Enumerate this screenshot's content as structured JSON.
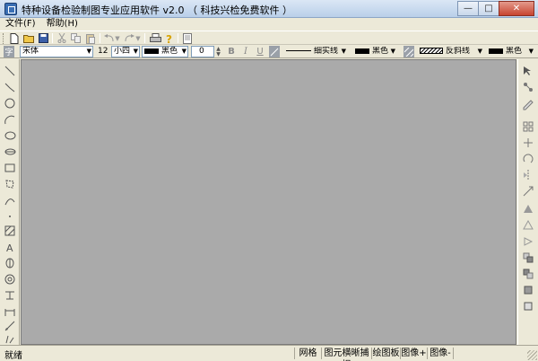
{
  "window": {
    "title": "特种设备检验制图专业应用软件 v2.0 （ 科技兴检免费软件 ）",
    "minimize": "—",
    "maximize": "□",
    "close": "✕"
  },
  "menu": {
    "items": [
      {
        "label": "文件(F)"
      },
      {
        "label": "帮助(H)"
      }
    ]
  },
  "toolbar1": {
    "icons": [
      "new-icon",
      "open-icon",
      "save-icon",
      "cut-icon",
      "copy-icon",
      "paste-icon",
      "undo-icon",
      "redo-icon",
      "print-icon",
      "help-icon",
      "preview-icon"
    ]
  },
  "toolbar2": {
    "font_name": "宋体",
    "font_size": "12",
    "font_size_name": "小四",
    "font_color": "黑色",
    "spacing": "0",
    "bold": "B",
    "italic": "I",
    "underline": "U",
    "line_type": "细实线",
    "line_color": "黑色",
    "hatch_type": "反斜线",
    "hatch_color": "黑色"
  },
  "left_tools": [
    "line-icon",
    "polyline-icon",
    "circle-icon",
    "arc-icon",
    "ellipse-icon",
    "ellipse-arc-icon",
    "rectangle-icon",
    "polygon-icon",
    "curve-icon",
    "point-icon",
    "hatch-icon",
    "text-icon",
    "tank-icon",
    "flange-icon",
    "weld-icon",
    "dimension-icon",
    "leader-icon",
    "angle-dimension-icon"
  ],
  "right_tools": [
    "select-icon",
    "node-icon",
    "edit-icon",
    "group-icon",
    "move-icon",
    "rotate-icon",
    "mirror-icon",
    "align-top-icon",
    "align-middle-icon",
    "align-bottom-icon",
    "bring-front-icon",
    "send-back-icon",
    "layer-up-icon",
    "layer-down-icon"
  ],
  "status": {
    "ready": "就绪",
    "grid": "网格",
    "snap": "图元横晰捕捉",
    "board": "绘图板",
    "image_plus": "图像+",
    "image_minus": "图像-"
  }
}
